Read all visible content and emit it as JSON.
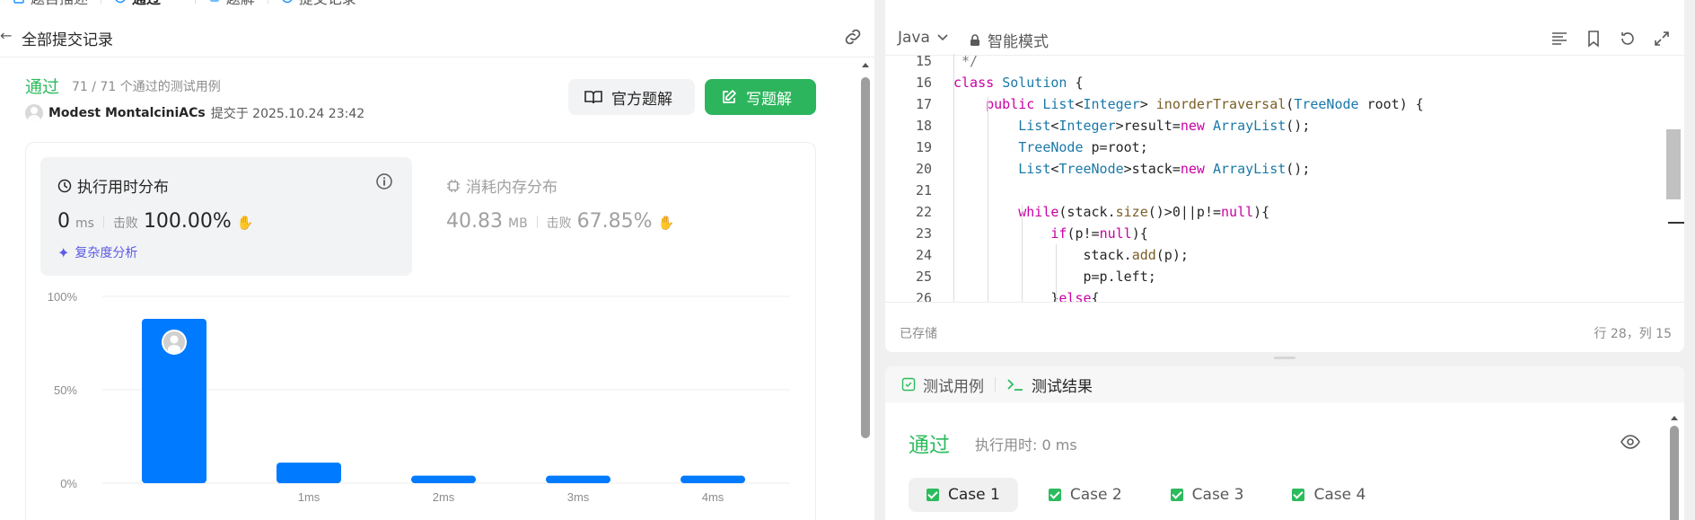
{
  "tabs": [
    {
      "label": "题目描述",
      "active": false
    },
    {
      "label": "通过",
      "active": true,
      "closable": true
    },
    {
      "label": "题解",
      "active": false
    },
    {
      "label": "提交记录",
      "active": false
    }
  ],
  "subheader": {
    "back_label": "全部提交记录"
  },
  "submission": {
    "status": "通过",
    "passed_text": "71 / 71 个通过的测试用例",
    "author": "Modest MontalciniACs",
    "submitted_text": "提交于 2025.10.24 23:42",
    "official_solution_label": "官方题解",
    "write_solution_label": "写题解"
  },
  "runtime": {
    "title": "执行用时分布",
    "value": "0",
    "unit": "ms",
    "beat_label": "击败",
    "beat_pct": "100.00%",
    "complexity_label": "复杂度分析"
  },
  "memory": {
    "title": "消耗内存分布",
    "value": "40.83",
    "unit": "MB",
    "beat_label": "击败",
    "beat_pct": "67.85%"
  },
  "chart_data": {
    "type": "bar",
    "categories": [
      "",
      "1ms",
      "2ms",
      "3ms",
      "4ms"
    ],
    "values": [
      88,
      11,
      4,
      4,
      4
    ],
    "y_tick_labels": [
      "100%",
      "50%",
      "0%"
    ],
    "ylim": [
      0,
      100
    ],
    "highlight_index": 0,
    "bar_color": "#007aff",
    "grid": true
  },
  "editor": {
    "language": "Java",
    "mode_label": "智能模式",
    "code_lines": [
      {
        "n": "15",
        "text": " */"
      },
      {
        "n": "16",
        "text": "class Solution {"
      },
      {
        "n": "17",
        "text": "    public List<Integer> inorderTraversal(TreeNode root) {"
      },
      {
        "n": "18",
        "text": "        List<Integer>result=new ArrayList();"
      },
      {
        "n": "19",
        "text": "        TreeNode p=root;"
      },
      {
        "n": "20",
        "text": "        List<TreeNode>stack=new ArrayList();"
      },
      {
        "n": "21",
        "text": ""
      },
      {
        "n": "22",
        "text": "        while(stack.size()>0||p!=null){"
      },
      {
        "n": "23",
        "text": "            if(p!=null){"
      },
      {
        "n": "24",
        "text": "                stack.add(p);"
      },
      {
        "n": "25",
        "text": "                p=p.left;"
      },
      {
        "n": "26",
        "text": "            }else{"
      }
    ],
    "saved_label": "已存储",
    "cursor_pos": "行 28，列 15"
  },
  "results": {
    "tab_testcase": "测试用例",
    "tab_result": "测试结果",
    "status": "通过",
    "exec_time": "执行用时: 0 ms",
    "cases": [
      "Case 1",
      "Case 2",
      "Case 3",
      "Case 4"
    ]
  },
  "colors": {
    "accent_green": "#2cbb5d",
    "bar_blue": "#007aff",
    "purple": "#5a5ae6"
  }
}
